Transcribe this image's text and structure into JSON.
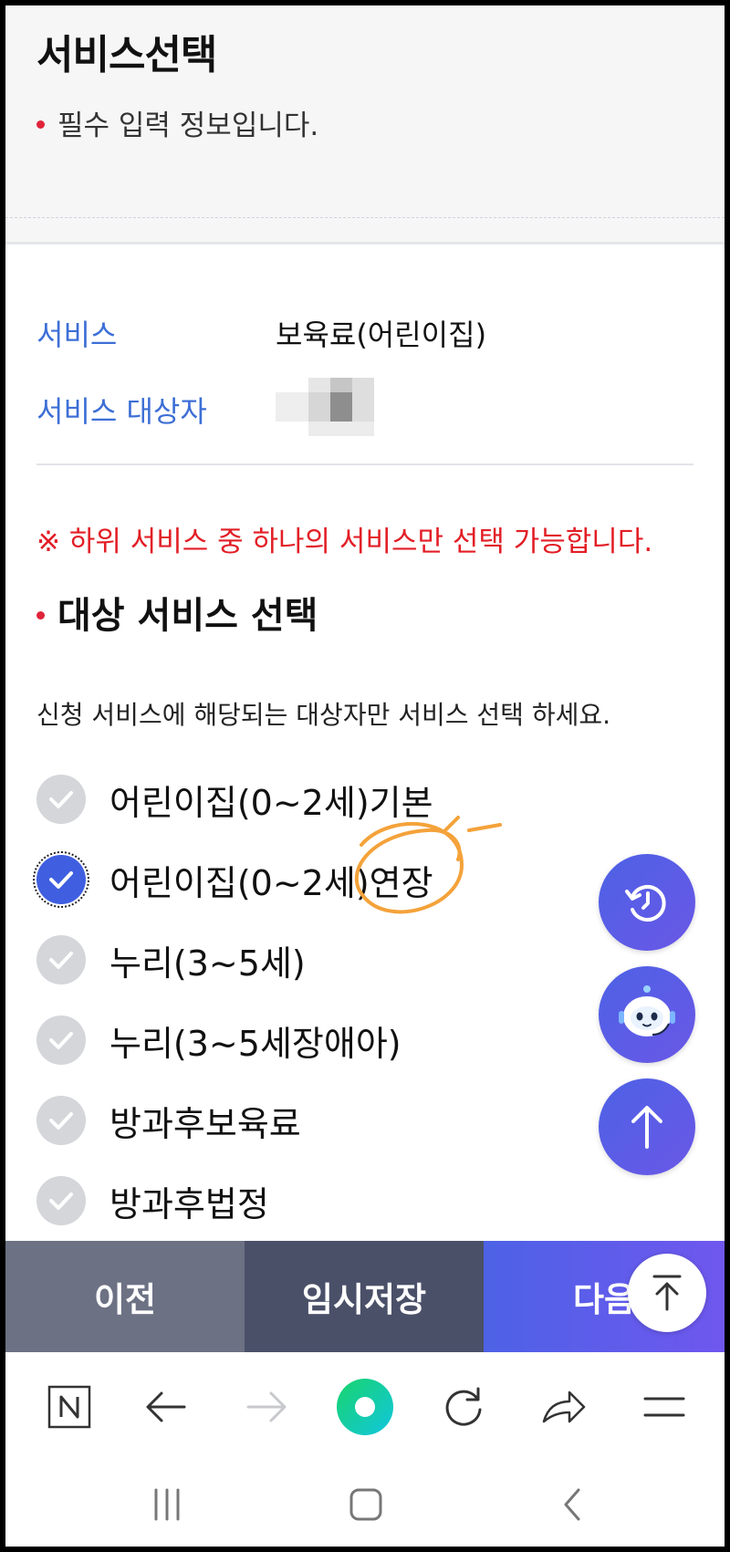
{
  "header": {
    "title": "서비스선택",
    "required_note": "필수 입력 정보입니다."
  },
  "info": {
    "service_label": "서비스",
    "service_value": "보육료(어린이집)",
    "target_label": "서비스 대상자"
  },
  "notice": "※ 하위 서비스 중 하나의 서비스만 선택 가능합니다.",
  "section_title": "대상 서비스 선택",
  "description": "신청 서비스에 해당되는 대상자만 서비스 선택 하세요.",
  "options": [
    {
      "label": "어린이집(0~2세)기본",
      "checked": false
    },
    {
      "label": "어린이집(0~2세)연장",
      "checked": true
    },
    {
      "label": "누리(3~5세)",
      "checked": false
    },
    {
      "label": "누리(3~5세장애아)",
      "checked": false
    },
    {
      "label": "방과후보육료",
      "checked": false
    },
    {
      "label": "방과후법정",
      "checked": false
    }
  ],
  "buttons": {
    "prev": "이전",
    "temp_save": "임시저장",
    "next": "다음"
  },
  "icons": {
    "fabs": [
      "history-icon",
      "chatbot-icon",
      "scroll-up-icon"
    ],
    "nav": [
      "naver-home-icon",
      "back-arrow-icon",
      "forward-arrow-icon",
      "green-dot-icon",
      "reload-icon",
      "share-icon",
      "menu-icon"
    ],
    "system": [
      "recent-apps-icon",
      "home-icon",
      "system-back-icon"
    ]
  },
  "colors": {
    "accent": "#3d6fd6",
    "notice": "#e21e26",
    "checked": "#3f5fe0",
    "unchecked": "#d4d6da",
    "annotation": "#f4a23a"
  }
}
